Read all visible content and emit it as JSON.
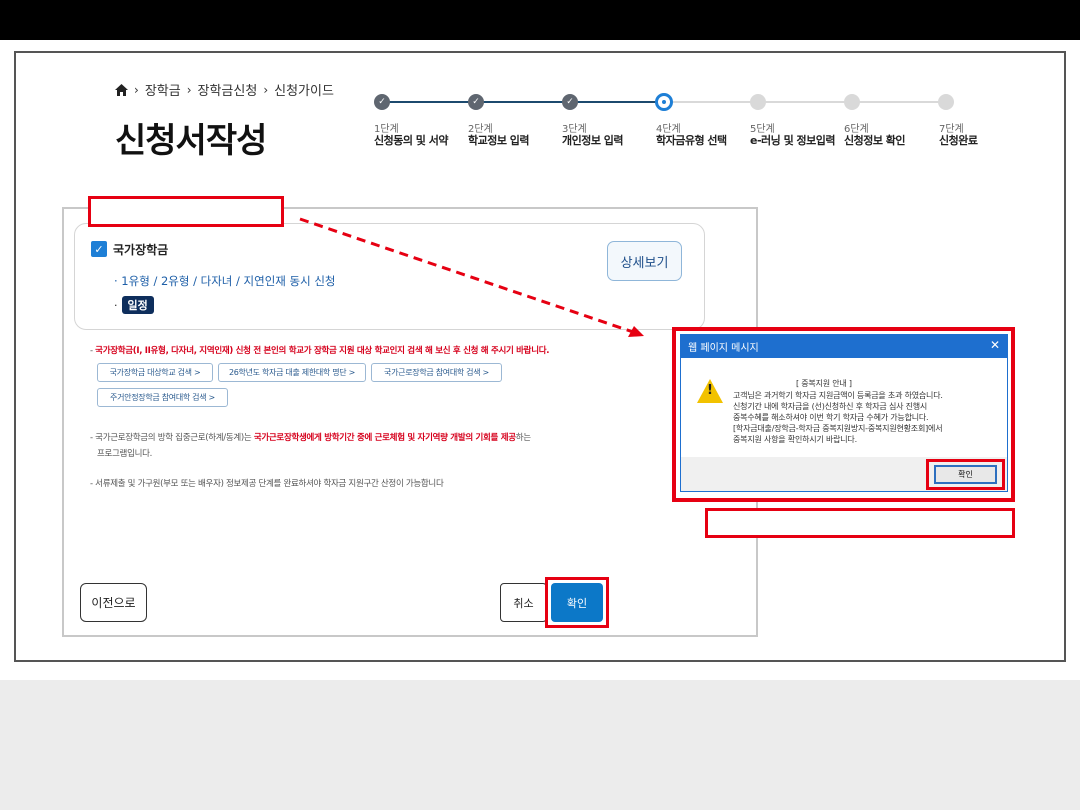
{
  "breadcrumb": {
    "home": "home-icon",
    "items": [
      "장학금",
      "장학금신청",
      "신청가이드"
    ]
  },
  "page_title": "신청서작성",
  "steps": [
    {
      "num": "1단계",
      "name": "신청동의 및 서약",
      "state": "done"
    },
    {
      "num": "2단계",
      "name": "학교정보 입력",
      "state": "done"
    },
    {
      "num": "3단계",
      "name": "개인정보 입력",
      "state": "done"
    },
    {
      "num": "4단계",
      "name": "학자금유형 선택",
      "state": "current"
    },
    {
      "num": "5단계",
      "name": "e-러닝 및 정보입력",
      "state": "todo"
    },
    {
      "num": "6단계",
      "name": "신청정보 확인",
      "state": "todo"
    },
    {
      "num": "7단계",
      "name": "신청완료",
      "state": "todo"
    }
  ],
  "card": {
    "title": "국가장학금",
    "subtitle": "· 1유형 / 2유형 / 다자녀 / 지연인재 동시 신청",
    "tag_prefix": "·",
    "tag": "일정",
    "detail_button": "상세보기"
  },
  "notices": {
    "n1_prefix": "- ",
    "n1_red": "국가장학금(I, II유형, 다자녀, 지역인재) 신청 전 본인의 학교가 장학금 지원 대상 학교인지 검색 해 보신 후 신청 해 주시기 바랍니다.",
    "links": [
      "국가장학금 대상학교 검색  >",
      "26학년도 학자금 대출 제한대학 명단  >",
      "국가근로장학금 참여대학 검색  >",
      "주거안정장학금 참여대학 검색  >"
    ],
    "n2_a": "- 국가근로장학금의 방학 집중근로(하계/동계)는 ",
    "n2_red": "국가근로장학생에게 방학기간 중에 근로체험 및 자기역량 개발의 기회를 제공",
    "n2_b": "하는",
    "n2_c": "프로그램입니다.",
    "n3": "- 서류제출 및 가구원(부모 또는 배우자) 정보제공 단계를 완료하셔야 학자금 지원구간 산정이 가능합니다"
  },
  "buttons": {
    "prev": "이전으로",
    "cancel": "취소",
    "ok": "확인"
  },
  "dialog": {
    "title": "웹 페이지 메시지",
    "close": "✕",
    "icon": "warning-icon",
    "mark": "!",
    "lines": [
      "[ 중복지원 안내 ]",
      "고객님은 과거학기 학자금 지원금액이 등록금을 초과 하였습니다.",
      "신청기간 내에 학자금을 (선)신청하신 후 학자금 심사 진행시",
      "중복수혜를 해소하셔야 이번 학기 학자금 수혜가 가능합니다.",
      "[학자금대출/장학금-학자금 중복지원방지-중복지원현황조회]에서",
      "중복지원 사항을 확인하시기 바랍니다."
    ],
    "ok": "확인"
  },
  "colors": {
    "annotation_red": "#e60012",
    "primary_blue": "#0c78c8",
    "dialog_blue": "#1e6fcf"
  }
}
